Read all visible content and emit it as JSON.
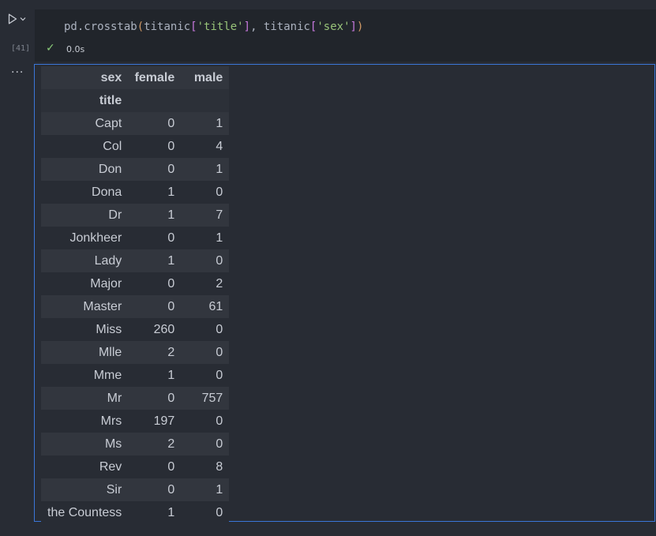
{
  "cell": {
    "code_parts": [
      "pd.crosstab",
      "(",
      "titanic",
      "[",
      "'title'",
      "]",
      ", titanic",
      "[",
      "'sex'",
      "]",
      ")"
    ],
    "execution_count": "[41]",
    "status_check": "✓",
    "duration": "0.0s",
    "output_menu": "..."
  },
  "table": {
    "columns_name": "sex",
    "index_name": "title",
    "columns": [
      "female",
      "male"
    ],
    "rows": [
      {
        "title": "Capt",
        "female": "0",
        "male": "1"
      },
      {
        "title": "Col",
        "female": "0",
        "male": "4"
      },
      {
        "title": "Don",
        "female": "0",
        "male": "1"
      },
      {
        "title": "Dona",
        "female": "1",
        "male": "0"
      },
      {
        "title": "Dr",
        "female": "1",
        "male": "7"
      },
      {
        "title": "Jonkheer",
        "female": "0",
        "male": "1"
      },
      {
        "title": "Lady",
        "female": "1",
        "male": "0"
      },
      {
        "title": "Major",
        "female": "0",
        "male": "2"
      },
      {
        "title": "Master",
        "female": "0",
        "male": "61"
      },
      {
        "title": "Miss",
        "female": "260",
        "male": "0"
      },
      {
        "title": "Mlle",
        "female": "2",
        "male": "0"
      },
      {
        "title": "Mme",
        "female": "1",
        "male": "0"
      },
      {
        "title": "Mr",
        "female": "0",
        "male": "757"
      },
      {
        "title": "Mrs",
        "female": "197",
        "male": "0"
      },
      {
        "title": "Ms",
        "female": "2",
        "male": "0"
      },
      {
        "title": "Rev",
        "female": "0",
        "male": "8"
      },
      {
        "title": "Sir",
        "female": "0",
        "male": "1"
      },
      {
        "title": "the Countess",
        "female": "1",
        "male": "0"
      }
    ]
  },
  "icons": {
    "run": "play-icon",
    "run_menu": "chevron-down-icon",
    "success": "check-icon",
    "output_menu": "ellipsis-icon"
  },
  "colors": {
    "background": "#282c34",
    "code_background": "#21252b",
    "output_border": "#3a76d8",
    "success": "#89ca78",
    "string": "#98c379"
  }
}
